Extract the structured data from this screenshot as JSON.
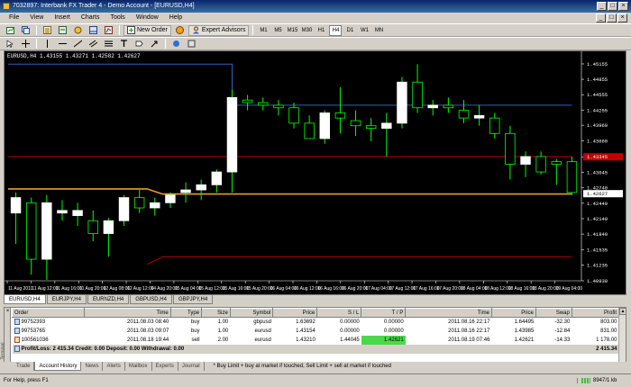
{
  "window": {
    "title": "7032897: Interbank FX Trader 4 - Demo Account - [EURUSD,H4]",
    "controls": [
      "_",
      "□",
      "×"
    ]
  },
  "menu": [
    "File",
    "View",
    "Insert",
    "Charts",
    "Tools",
    "Window",
    "Help"
  ],
  "toolbar": {
    "new_order": "New Order",
    "expert_advisors": "Expert Advisors",
    "timeframes": [
      "M1",
      "M5",
      "M15",
      "M30",
      "H1",
      "H4",
      "D1",
      "W1",
      "MN"
    ],
    "active_timeframe": "H4"
  },
  "chart": {
    "info": "EURUSD,H4  1.43155 1.43271 1.42582 1.42627",
    "bg_color": "#000000",
    "bull_color": "#ffffff",
    "bear_color": "#00ff00",
    "current_price_label": "1.42627",
    "marker_price_label": "1.43345"
  },
  "chart_data": {
    "type": "candlestick",
    "symbol": "EURUSD",
    "timeframe": "H4",
    "y_ticks": [
      "1.45155",
      "1.44855",
      "1.44555",
      "1.44255",
      "1.43960",
      "1.43660",
      "1.43345",
      "1.43045",
      "1.42740",
      "1.42440",
      "1.42140",
      "1.41840",
      "1.41535",
      "1.41235",
      "1.40930"
    ],
    "ylim": [
      1.4093,
      1.4533
    ],
    "x_ticks": [
      "11 Aug 2011",
      "11 Aug 12:00",
      "11 Aug 16:00",
      "11 Aug 20:00",
      "12 Aug 08:00",
      "12 Aug 12:00",
      "14 Aug 20:00",
      "15 Aug 04:00",
      "15 Aug 12:00",
      "15 Aug 16:00",
      "15 Aug 20:00",
      "16 Aug 04:00",
      "16 Aug 12:00",
      "16 Aug 16:00",
      "16 Aug 20:00",
      "17 Aug 04:00",
      "17 Aug 12:00",
      "17 Aug 16:00",
      "17 Aug 20:00",
      "18 Aug 04:00",
      "18 Aug 12:00",
      "18 Aug 16:00",
      "18 Aug 20:00",
      "19 Aug 04:00"
    ],
    "candles": [
      {
        "o": 1.4225,
        "h": 1.4265,
        "l": 1.4165,
        "c": 1.4255
      },
      {
        "o": 1.4245,
        "h": 1.4255,
        "l": 1.4105,
        "c": 1.4135
      },
      {
        "o": 1.4135,
        "h": 1.426,
        "l": 1.4095,
        "c": 1.4245
      },
      {
        "o": 1.4225,
        "h": 1.425,
        "l": 1.421,
        "c": 1.423
      },
      {
        "o": 1.422,
        "h": 1.4245,
        "l": 1.42,
        "c": 1.423
      },
      {
        "o": 1.421,
        "h": 1.423,
        "l": 1.417,
        "c": 1.4185
      },
      {
        "o": 1.4185,
        "h": 1.4215,
        "l": 1.414,
        "c": 1.421
      },
      {
        "o": 1.421,
        "h": 1.426,
        "l": 1.42,
        "c": 1.4255
      },
      {
        "o": 1.4255,
        "h": 1.427,
        "l": 1.4225,
        "c": 1.4235
      },
      {
        "o": 1.4235,
        "h": 1.4255,
        "l": 1.422,
        "c": 1.4245
      },
      {
        "o": 1.4245,
        "h": 1.4265,
        "l": 1.4235,
        "c": 1.426
      },
      {
        "o": 1.4265,
        "h": 1.4285,
        "l": 1.4245,
        "c": 1.427
      },
      {
        "o": 1.427,
        "h": 1.429,
        "l": 1.425,
        "c": 1.428
      },
      {
        "o": 1.428,
        "h": 1.431,
        "l": 1.4265,
        "c": 1.4305
      },
      {
        "o": 1.4305,
        "h": 1.4465,
        "l": 1.4265,
        "c": 1.445
      },
      {
        "o": 1.4445,
        "h": 1.4455,
        "l": 1.4425,
        "c": 1.444
      },
      {
        "o": 1.444,
        "h": 1.445,
        "l": 1.4425,
        "c": 1.4435
      },
      {
        "o": 1.4435,
        "h": 1.4445,
        "l": 1.4415,
        "c": 1.443
      },
      {
        "o": 1.443,
        "h": 1.444,
        "l": 1.439,
        "c": 1.44
      },
      {
        "o": 1.44,
        "h": 1.4415,
        "l": 1.437,
        "c": 1.437
      },
      {
        "o": 1.437,
        "h": 1.4425,
        "l": 1.436,
        "c": 1.442
      },
      {
        "o": 1.442,
        "h": 1.447,
        "l": 1.438,
        "c": 1.441
      },
      {
        "o": 1.4405,
        "h": 1.4425,
        "l": 1.4375,
        "c": 1.4395
      },
      {
        "o": 1.4395,
        "h": 1.441,
        "l": 1.4365,
        "c": 1.439
      },
      {
        "o": 1.439,
        "h": 1.442,
        "l": 1.4335,
        "c": 1.44
      },
      {
        "o": 1.44,
        "h": 1.449,
        "l": 1.439,
        "c": 1.448
      },
      {
        "o": 1.448,
        "h": 1.4515,
        "l": 1.442,
        "c": 1.443
      },
      {
        "o": 1.443,
        "h": 1.4445,
        "l": 1.4415,
        "c": 1.4435
      },
      {
        "o": 1.4435,
        "h": 1.445,
        "l": 1.442,
        "c": 1.443
      },
      {
        "o": 1.4425,
        "h": 1.4445,
        "l": 1.44,
        "c": 1.441
      },
      {
        "o": 1.441,
        "h": 1.4435,
        "l": 1.4395,
        "c": 1.4415
      },
      {
        "o": 1.441,
        "h": 1.442,
        "l": 1.437,
        "c": 1.438
      },
      {
        "o": 1.438,
        "h": 1.4395,
        "l": 1.429,
        "c": 1.432
      },
      {
        "o": 1.432,
        "h": 1.4345,
        "l": 1.4295,
        "c": 1.4335
      },
      {
        "o": 1.4335,
        "h": 1.4345,
        "l": 1.43,
        "c": 1.4305
      },
      {
        "o": 1.4325,
        "h": 1.433,
        "l": 1.428,
        "c": 1.432
      },
      {
        "o": 1.4325,
        "h": 1.4335,
        "l": 1.426,
        "c": 1.4265
      }
    ],
    "lines": [
      {
        "name": "upper-band",
        "color": "#3060c0",
        "points": [
          [
            0,
            1.4515
          ],
          [
            14.5,
            1.4515
          ],
          [
            14.5,
            1.4435
          ],
          [
            36.5,
            1.4435
          ]
        ]
      },
      {
        "name": "price-line",
        "color": "#c00000",
        "points": [
          [
            0,
            1.4335
          ],
          [
            36.5,
            1.4335
          ]
        ]
      },
      {
        "name": "orange-line",
        "color": "#e8a020",
        "points": [
          [
            0,
            1.4272
          ],
          [
            9,
            1.4272
          ],
          [
            10,
            1.4262
          ],
          [
            36.5,
            1.4262
          ]
        ]
      },
      {
        "name": "lower-band",
        "color": "#c00000",
        "points": [
          [
            9,
            1.4125
          ],
          [
            10,
            1.414
          ],
          [
            36.5,
            1.414
          ]
        ]
      }
    ]
  },
  "chart_tabs": [
    "EURUSD,H4",
    "EURJPY,H4",
    "EURNZD,H4",
    "GBPUSD,H4",
    "GBPJPY,H4"
  ],
  "orders": {
    "columns": [
      "Order",
      "Time",
      "Type",
      "Size",
      "Symbol",
      "Price",
      "S / L",
      "T / P",
      "Time",
      "Price",
      "Swap",
      "Profit"
    ],
    "rows": [
      {
        "order": "99752393",
        "time": "2011.08.03 08:40",
        "type": "buy",
        "size": "1.00",
        "symbol": "gbpusd",
        "price": "1.63692",
        "sl": "0.00000",
        "tp": "0.00000",
        "ctime": "2011.08.16 22:17",
        "cprice": "1.64495",
        "swap": "-32.30",
        "profit": "803.00"
      },
      {
        "order": "99753765",
        "time": "2011.08.03 09:07",
        "type": "buy",
        "size": "1.00",
        "symbol": "eurusd",
        "price": "1.43154",
        "sl": "0.00000",
        "tp": "0.00000",
        "ctime": "2011.08.16 22:17",
        "cprice": "1.43985",
        "swap": "-12.84",
        "profit": "831.00"
      },
      {
        "order": "100561036",
        "time": "2011.08.18 19:44",
        "type": "sell",
        "size": "2.00",
        "symbol": "eurusd",
        "price": "1.43210",
        "sl": "1.44045",
        "tp": "1.42621",
        "ctime": "2011.08.19 07:46",
        "cprice": "1.42621",
        "swap": "-14.33",
        "profit": "1 178.00"
      }
    ],
    "summary": "Profit/Loss: 2 415.34  Credit: 0.00  Deposit: 0.00  Withdrawal: 0.00",
    "summary_total": "2 415.34"
  },
  "terminal": {
    "side_label": "Terminal",
    "close": "×",
    "tabs": [
      "Trade",
      "Account History",
      "News",
      "Alerts",
      "Mailbox",
      "Experts",
      "Journal"
    ],
    "active_tab": "Account History",
    "hint": "* Buy Limit + buy at market if touched, Sell Limit + sell at market if touched"
  },
  "status": {
    "help": "For Help, press F1",
    "traffic": "8947/1 kb"
  }
}
